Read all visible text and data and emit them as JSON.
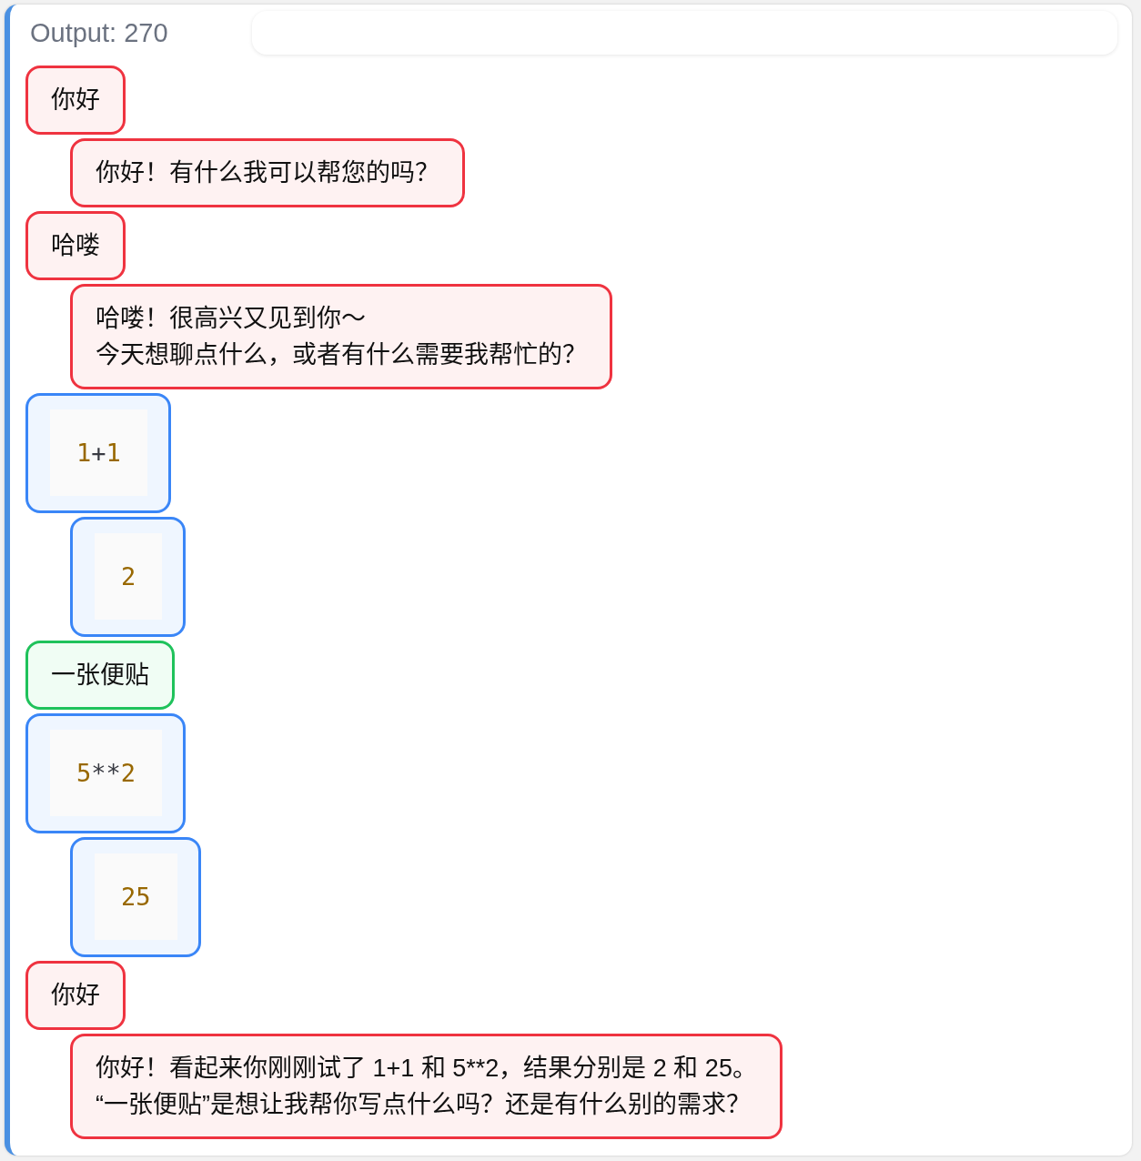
{
  "header": {
    "title": "Output: 270"
  },
  "exchanges": [
    {
      "prompt": {
        "kind": "text",
        "lines": [
          "你好"
        ]
      },
      "replies": [
        {
          "kind": "text",
          "lines": [
            "你好！有什么我可以帮您的吗？"
          ]
        }
      ]
    },
    {
      "prompt": {
        "kind": "text",
        "lines": [
          "哈喽"
        ]
      },
      "replies": [
        {
          "kind": "text",
          "lines": [
            "哈喽！很高兴又见到你～",
            "今天想聊点什么，或者有什么需要我帮忙的？"
          ]
        }
      ]
    },
    {
      "prompt": {
        "kind": "code",
        "tokens": [
          {
            "kind": "number",
            "text": "1"
          },
          {
            "kind": "operator",
            "text": "+"
          },
          {
            "kind": "number",
            "text": "1"
          }
        ]
      },
      "replies": [
        {
          "kind": "code",
          "tokens": [
            {
              "kind": "number",
              "text": "2"
            }
          ]
        }
      ]
    },
    {
      "prompt": {
        "kind": "note",
        "lines": [
          "一张便贴"
        ]
      }
    },
    {
      "prompt": {
        "kind": "code",
        "tokens": [
          {
            "kind": "number",
            "text": "5"
          },
          {
            "kind": "operator",
            "text": "**"
          },
          {
            "kind": "number",
            "text": "2"
          }
        ]
      },
      "replies": [
        {
          "kind": "code",
          "tokens": [
            {
              "kind": "number",
              "text": "25"
            }
          ]
        }
      ]
    },
    {
      "prompt": {
        "kind": "text",
        "lines": [
          "你好"
        ]
      },
      "replies": [
        {
          "kind": "text",
          "lines": [
            "你好！看起来你刚刚试了 1+1 和 5**2，结果分别是 2 和 25。",
            "“一张便贴”是想让我帮你写点什么吗？还是有什么别的需求？"
          ]
        }
      ]
    }
  ]
}
